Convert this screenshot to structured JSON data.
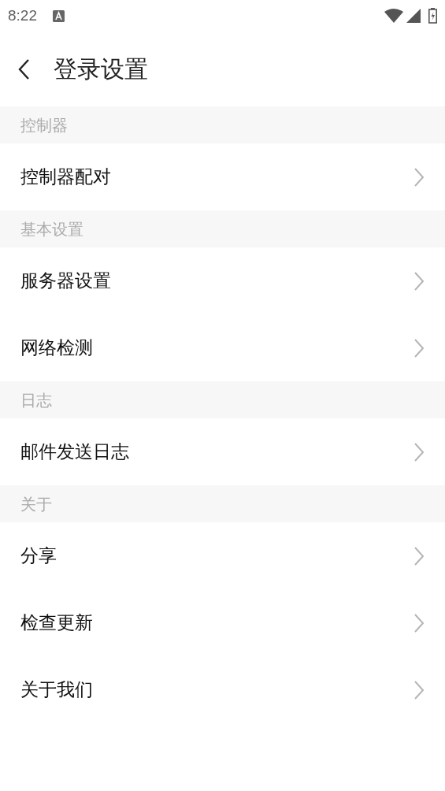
{
  "status_bar": {
    "time": "8:22"
  },
  "header": {
    "title": "登录设置"
  },
  "sections": [
    {
      "title": "控制器",
      "items": [
        "控制器配对"
      ]
    },
    {
      "title": "基本设置",
      "items": [
        "服务器设置",
        "网络检测"
      ]
    },
    {
      "title": "日志",
      "items": [
        "邮件发送日志"
      ]
    },
    {
      "title": "关于",
      "items": [
        "分享",
        "检查更新",
        "关于我们"
      ]
    }
  ]
}
